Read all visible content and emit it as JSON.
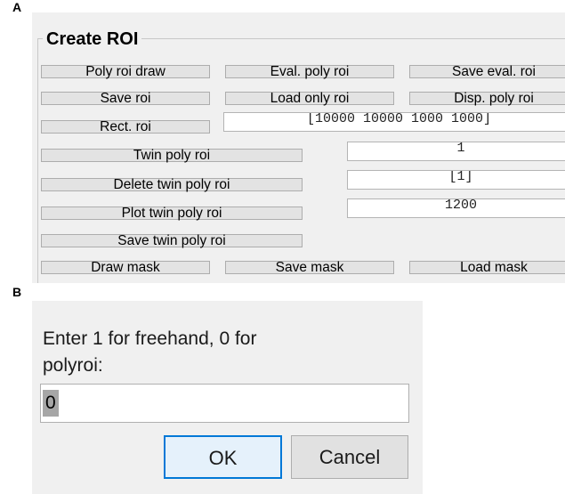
{
  "labels": {
    "panel_a": "A",
    "panel_b": "B"
  },
  "create_roi": {
    "title": "Create ROI",
    "buttons": {
      "poly_roi_draw": "Poly roi draw",
      "eval_poly_roi": "Eval. poly roi",
      "save_eval_roi": "Save eval. roi",
      "save_roi": "Save roi",
      "load_only_roi": "Load only roi",
      "disp_poly_roi": "Disp. poly roi",
      "rect_roi": "Rect. roi",
      "twin_poly_roi": "Twin poly roi",
      "delete_twin_poly_roi": "Delete twin poly roi",
      "plot_twin_poly_roi": "Plot twin poly roi",
      "save_twin_poly_roi": "Save twin poly roi",
      "draw_mask": "Draw mask",
      "save_mask": "Save mask",
      "load_mask": "Load mask"
    },
    "fields": {
      "rect_roi_value": "[10000 10000 1000 1000]",
      "twin_poly_roi_value": "1",
      "delete_twin_poly_roi_value": "[1]",
      "plot_twin_poly_roi_value": "1200"
    }
  },
  "dialog": {
    "prompt_line1": "Enter 1 for freehand, 0 for",
    "prompt_line2": "polyroi:",
    "input_value": "0",
    "ok_label": "OK",
    "cancel_label": "Cancel"
  },
  "colors": {
    "window_bg": "#f0f0f0",
    "button_face": "#e3e3e3",
    "button_border": "#adadad",
    "ok_border": "#0078d7",
    "ok_face": "#e5f1fb",
    "selection": "#a6a6a6"
  }
}
